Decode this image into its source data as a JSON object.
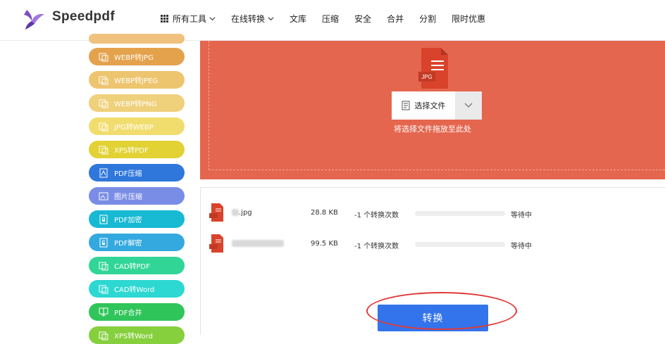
{
  "brand": {
    "name": "Speedpdf"
  },
  "nav": [
    {
      "label": "所有工具",
      "icon": "grid-icon",
      "dropdown": true
    },
    {
      "label": "在线转换",
      "dropdown": true
    },
    {
      "label": "文库"
    },
    {
      "label": "压缩"
    },
    {
      "label": "安全"
    },
    {
      "label": "合并"
    },
    {
      "label": "分割"
    },
    {
      "label": "限时优惠"
    }
  ],
  "sidebar": {
    "items": [
      {
        "label": "",
        "color": "#f0c27e"
      },
      {
        "label": "WEBP转JPG",
        "color": "#e4a24c"
      },
      {
        "label": "WEBP转JPEG",
        "color": "#eec56f"
      },
      {
        "label": "WEBP转PNG",
        "color": "#efd07b"
      },
      {
        "label": "JPG转WEBP",
        "color": "#f1dd6e"
      },
      {
        "label": "XPS转PDF",
        "color": "#e2d234"
      },
      {
        "label": "PDF压缩",
        "color": "#2f77db"
      },
      {
        "label": "图片压缩",
        "color": "#7a8de6"
      },
      {
        "label": "PDF加密",
        "color": "#17b9d3"
      },
      {
        "label": "PDF解密",
        "color": "#34a9e0"
      },
      {
        "label": "CAD转PDF",
        "color": "#31d696"
      },
      {
        "label": "CAD转Word",
        "color": "#2ed8d2"
      },
      {
        "label": "PDF合并",
        "color": "#2fc55a"
      },
      {
        "label": "XPS转Word",
        "color": "#86cf3d"
      }
    ]
  },
  "upload": {
    "file_type_label": "JPG",
    "select_label": "选择文件",
    "drop_hint": "将选择文件拖放至此处",
    "bg_color": "#e5664f"
  },
  "files": [
    {
      "name_visible": ".jpg",
      "size": "28.8 KB",
      "count": "-1 个转换次数",
      "progress": 0,
      "status": "等待中"
    },
    {
      "name_visible": "",
      "size": "99.5 KB",
      "count": "-1 个转换次数",
      "progress": 0,
      "status": "等待中"
    }
  ],
  "convert": {
    "label": "转换",
    "color": "#3374ec"
  }
}
